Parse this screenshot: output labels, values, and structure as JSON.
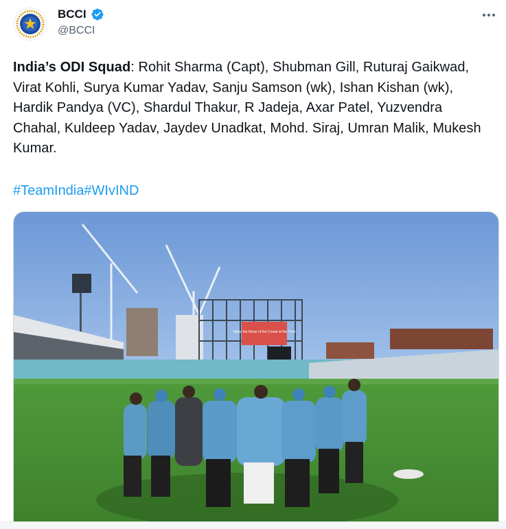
{
  "account": {
    "name": "BCCI",
    "handle": "@BCCI",
    "verified": true,
    "avatar_icon": "bcci-logo-icon"
  },
  "menu": {
    "icon": "more-options-icon"
  },
  "tweet": {
    "bold_label": "India’s ODI Squad",
    "body": ": Rohit Sharma (Capt), Shubman Gill, Ruturaj Gaikwad, Virat Kohli, Surya Kumar Yadav, Sanju Samson (wk), Ishan Kishan (wk), Hardik Pandya (VC), Shardul Thakur, R Jadeja, Axar Patel, Yuzvendra Chahal, Kuldeep Yadav, Jaydev Unadkat, Mohd. Siraj, Umran Malik, Mukesh Kumar.",
    "hashtags": [
      "#TeamIndia",
      "#WIvIND"
    ]
  },
  "media": {
    "scoreboard_text": "Make the Noise of the Crowd at the Oval"
  },
  "colors": {
    "link": "#1d9bf0",
    "verified": "#1d9bf0",
    "text": "#0f1419",
    "muted": "#536471"
  }
}
